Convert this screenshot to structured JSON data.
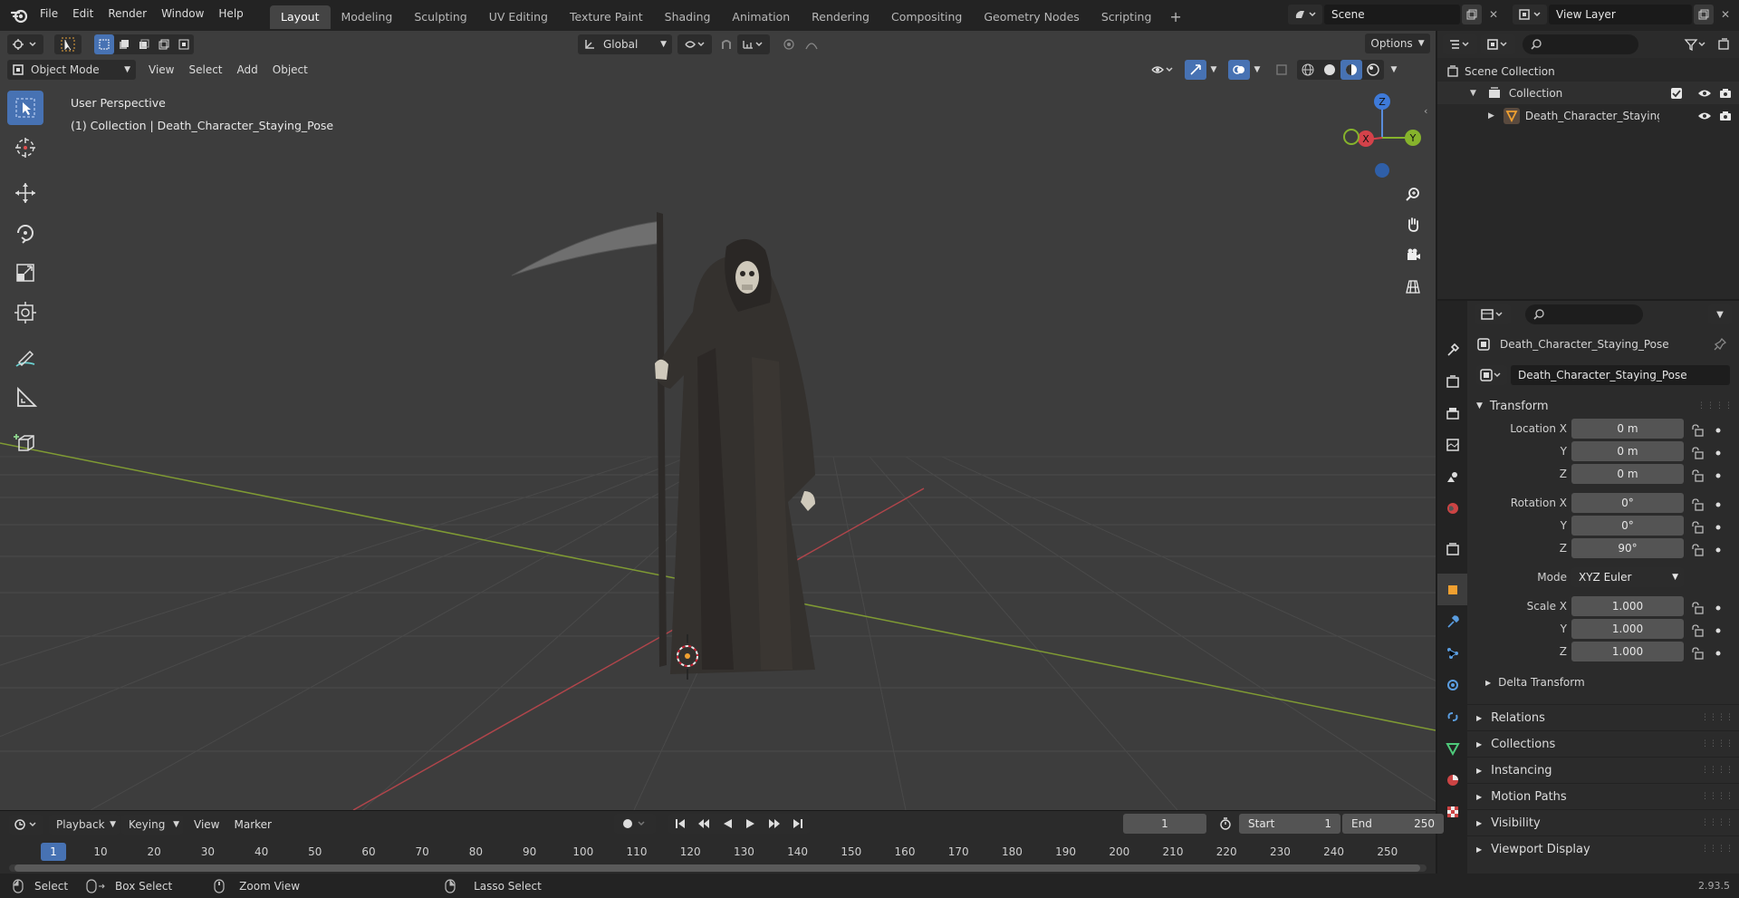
{
  "topbar": {
    "menus": [
      "File",
      "Edit",
      "Render",
      "Window",
      "Help"
    ],
    "workspaces": [
      "Layout",
      "Modeling",
      "Sculpting",
      "UV Editing",
      "Texture Paint",
      "Shading",
      "Animation",
      "Rendering",
      "Compositing",
      "Geometry Nodes",
      "Scripting"
    ],
    "active_workspace": "Layout",
    "scene_name": "Scene",
    "view_layer_name": "View Layer"
  },
  "viewport": {
    "mode": "Object Mode",
    "menus": [
      "View",
      "Select",
      "Add",
      "Object"
    ],
    "transform_orientation": "Global",
    "options_label": "Options",
    "perspective_label": "User Perspective",
    "collection_label": "(1) Collection | Death_Character_Staying_Pose",
    "gizmo_axes": {
      "x": "X",
      "y": "Y",
      "z": "Z"
    },
    "accent": "#4772b3"
  },
  "outliner": {
    "root": "Scene Collection",
    "collection": "Collection",
    "object": "Death_Character_Staying"
  },
  "properties": {
    "object_name_header": "Death_Character_Staying_Pose",
    "object_name_field": "Death_Character_Staying_Pose",
    "transform_title": "Transform",
    "location": {
      "label_x": "Location X",
      "label_y": "Y",
      "label_z": "Z",
      "x": "0 m",
      "y": "0 m",
      "z": "0 m"
    },
    "rotation": {
      "label_x": "Rotation X",
      "label_y": "Y",
      "label_z": "Z",
      "x": "0°",
      "y": "0°",
      "z": "90°"
    },
    "mode_label": "Mode",
    "mode_value": "XYZ Euler",
    "scale": {
      "label_x": "Scale X",
      "label_y": "Y",
      "label_z": "Z",
      "x": "1.000",
      "y": "1.000",
      "z": "1.000"
    },
    "delta_transform": "Delta Transform",
    "panels": [
      "Relations",
      "Collections",
      "Instancing",
      "Motion Paths",
      "Visibility",
      "Viewport Display"
    ]
  },
  "timeline": {
    "menus": [
      "Playback",
      "Keying",
      "View",
      "Marker"
    ],
    "current_frame": "1",
    "start_label": "Start",
    "start_value": "1",
    "end_label": "End",
    "end_value": "250",
    "ticks": [
      "1",
      "10",
      "20",
      "30",
      "40",
      "50",
      "60",
      "70",
      "80",
      "90",
      "100",
      "110",
      "120",
      "130",
      "140",
      "150",
      "160",
      "170",
      "180",
      "190",
      "200",
      "210",
      "220",
      "230",
      "240",
      "250"
    ]
  },
  "statusbar": {
    "select": "Select",
    "box_select": "Box Select",
    "zoom_view": "Zoom View",
    "lasso_select": "Lasso Select",
    "version": "2.93.5"
  }
}
